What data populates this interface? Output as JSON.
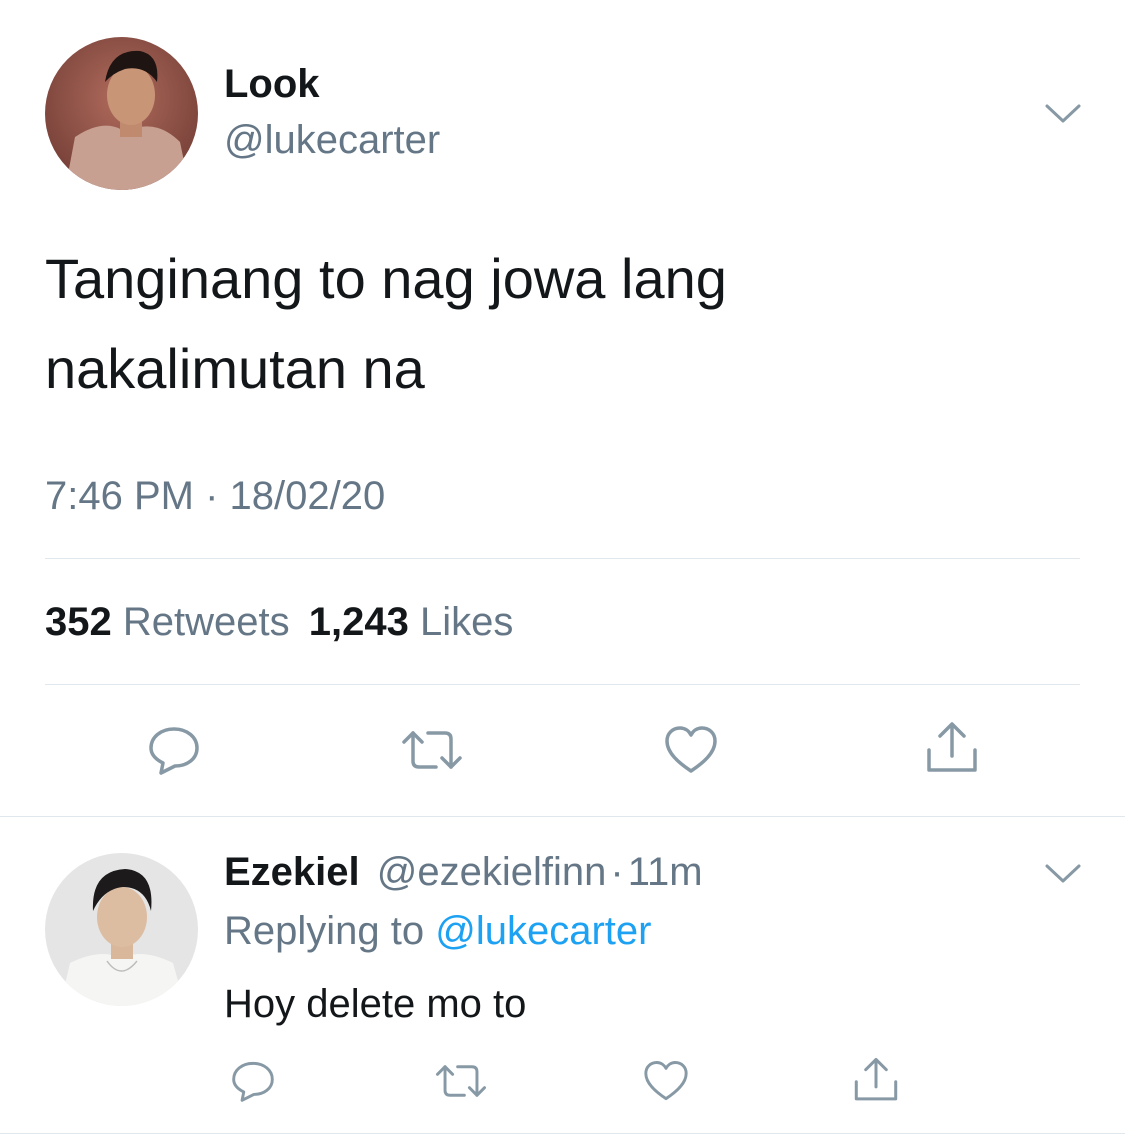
{
  "tweet": {
    "author": {
      "name": "Look",
      "handle": "@lukecarter",
      "avatar_icon": "user-avatar"
    },
    "text_line1": "Tanginang to nag jowa lang",
    "text_line2": "nakalimutan na",
    "timestamp": "7:46 PM · 18/02/20",
    "stats": {
      "retweets_count": "352",
      "retweets_label": "Retweets",
      "likes_count": "1,243",
      "likes_label": "Likes"
    },
    "actions": [
      "reply-icon",
      "retweet-icon",
      "like-icon",
      "share-icon"
    ],
    "menu_icon": "chevron-down-icon"
  },
  "reply": {
    "author": {
      "name": "Ezekiel",
      "handle": "@ezekielfinn",
      "separator": "·",
      "time": "11m",
      "avatar_icon": "user-avatar"
    },
    "replying_to_label": "Replying to",
    "replying_to_handle": "@lukecarter",
    "text": "Hoy delete mo to",
    "actions": [
      "reply-icon",
      "retweet-icon",
      "like-icon",
      "share-icon"
    ],
    "menu_icon": "chevron-down-icon"
  },
  "colors": {
    "text_primary": "#14171a",
    "text_secondary": "#657786",
    "link": "#1da1f2",
    "divider": "#e1e8ed"
  }
}
